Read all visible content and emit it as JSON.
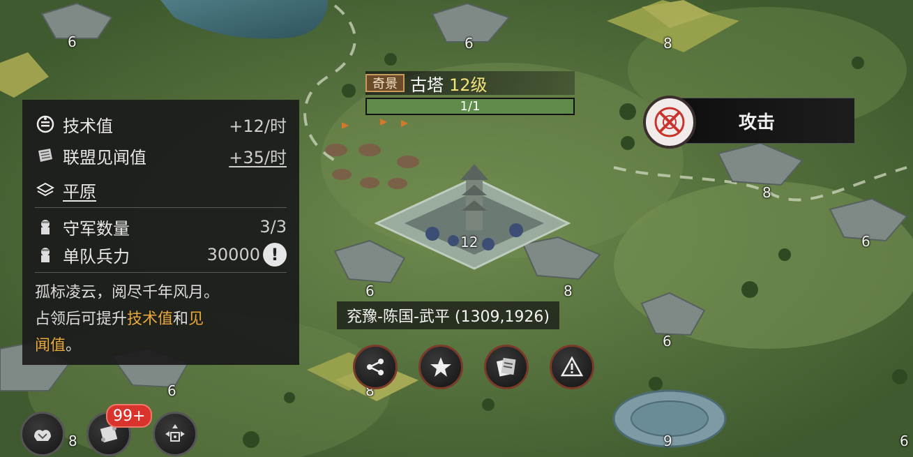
{
  "scenic": {
    "tag": "奇景",
    "name": "古塔",
    "level": "12级",
    "hp_text": "1/1",
    "hp_fraction": 1.0
  },
  "info_panel": {
    "tech_label": "技术值",
    "tech_value": "+12/时",
    "alliance_label": "联盟见闻值",
    "alliance_value": "+35/时",
    "terrain_label": "平原",
    "garrison_label": "守军数量",
    "garrison_value": "3/3",
    "troop_label": "单队兵力",
    "troop_value": "30000",
    "desc_line1": "孤标凌云，阅尽千年风月。",
    "desc_line2_a": "占领后可提升",
    "desc_hl1": "技术值",
    "desc_mid": "和",
    "desc_hl2a": "见",
    "desc_hl2b": "闻值",
    "desc_end": "。"
  },
  "attack": {
    "label": "攻击"
  },
  "location": {
    "text": "兖豫-陈国-武平 (1309,1926)"
  },
  "bottom_left": {
    "badge": "99+"
  },
  "map_tiles": [
    "6",
    "6",
    "8",
    "8",
    "6",
    "12",
    "6",
    "8",
    "6",
    "8",
    "6",
    "8",
    "9",
    "6"
  ],
  "colors": {
    "accent": "#e9a83a",
    "hp_fill": "#5f8c4a",
    "level": "#f2e27a",
    "badge": "#d8332c"
  },
  "icons": [
    "tech-icon",
    "scroll-icon",
    "terrain-icon",
    "soldier-icon",
    "warning-icon",
    "attack-icon",
    "share-icon",
    "star-icon",
    "report-icon",
    "alert-icon",
    "alliance-icon",
    "map-scroll-icon",
    "formation-icon"
  ]
}
